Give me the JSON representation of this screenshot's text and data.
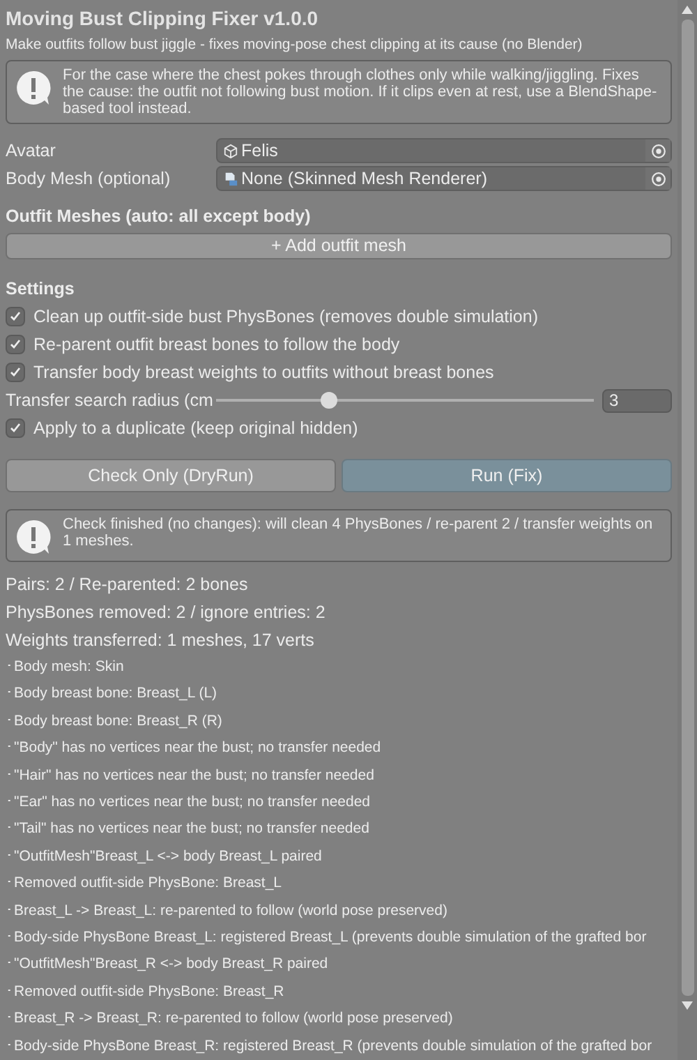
{
  "title": "Moving Bust Clipping Fixer v1.0.0",
  "subtitle": "Make outfits follow bust jiggle - fixes moving-pose chest clipping at its cause (no Blender)",
  "intro_notice": "For the case where the chest pokes through clothes only while walking/jiggling. Fixes the cause: the outfit not following bust motion. If it clips even at rest, use a BlendShape-based tool instead.",
  "fields": [
    {
      "label": "Avatar",
      "value": "Felis",
      "kind": "object"
    },
    {
      "label": "Body Mesh (optional)",
      "value": "None (Skinned Mesh Renderer)",
      "kind": "mesh"
    }
  ],
  "outfit_section": {
    "heading": "Outfit Meshes (auto: all except body)",
    "add_button": "+ Add outfit mesh"
  },
  "settings": {
    "heading": "Settings",
    "items": [
      {
        "kind": "checkbox",
        "label": "Clean up outfit-side bust PhysBones (removes double simulation)",
        "checked": true
      },
      {
        "kind": "checkbox",
        "label": "Re-parent outfit breast bones to follow the body",
        "checked": true
      },
      {
        "kind": "checkbox",
        "label": "Transfer body breast weights to outfits without breast bones",
        "checked": true
      },
      {
        "kind": "slider",
        "label": "Transfer search radius (cm",
        "level": 0.29,
        "value": "3"
      },
      {
        "kind": "checkbox",
        "label": "Apply to a duplicate (keep original hidden)",
        "checked": true
      }
    ]
  },
  "buttons": [
    {
      "label": "Check Only (DryRun)",
      "kind": "normal"
    },
    {
      "label": "Run (Fix)",
      "kind": "primary"
    }
  ],
  "result_notice": "Check finished (no changes): will clean 4 PhysBones / re-parent 2 / transfer weights on 1 meshes.",
  "summary": [
    "Pairs: 2 / Re-parented: 2 bones",
    "PhysBones removed: 2 / ignore entries: 2",
    "Weights transferred: 1 meshes, 17 verts"
  ],
  "log": [
    "･Body mesh: Skin",
    "･Body breast bone: Breast_L (L)",
    "･Body breast bone: Breast_R (R)",
    "･\"Body\" has no vertices near the bust; no transfer needed",
    "･\"Hair\" has no vertices near the bust; no transfer needed",
    "･\"Ear\" has no vertices near the bust; no transfer needed",
    "･\"Tail\" has no vertices near the bust; no transfer needed",
    "･\"OutfitMesh\"Breast_L <-> body Breast_L paired",
    "･Removed outfit-side PhysBone: Breast_L",
    "･Breast_L -> Breast_L: re-parented to follow (world pose preserved)",
    "･Body-side PhysBone Breast_L: registered Breast_L (prevents double simulation of the grafted bor",
    "･\"OutfitMesh\"Breast_R <-> body Breast_R paired",
    "･Removed outfit-side PhysBone: Breast_R",
    "･Breast_R -> Breast_R: re-parented to follow (world pose preserved)",
    "･Body-side PhysBone Breast_R: registered Breast_R (prevents double simulation of the grafted bor"
  ]
}
